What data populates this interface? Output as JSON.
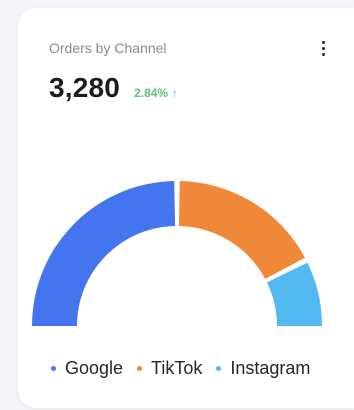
{
  "card": {
    "title": "Orders by Channel",
    "value": "3,280",
    "change": "2.84%",
    "change_icon": "arrow-up-icon",
    "menu_icon": "more-vertical-icon"
  },
  "chart_data": {
    "type": "pie",
    "style": "semi-donut",
    "categories": [
      "Google",
      "TikTok",
      "Instagram"
    ],
    "values": [
      50,
      35,
      15
    ],
    "colors": [
      "#4575ee",
      "#f0883a",
      "#54b9f0"
    ]
  }
}
